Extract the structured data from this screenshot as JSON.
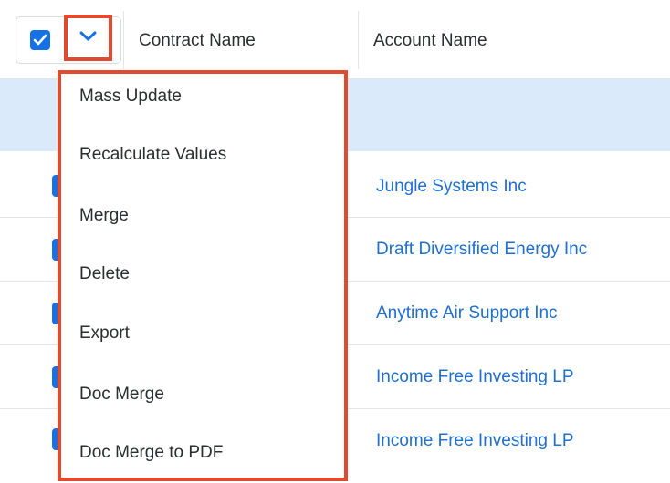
{
  "header": {
    "columns": [
      "Contract Name",
      "Account Name"
    ]
  },
  "actions_menu": {
    "items": [
      "Mass Update",
      "Recalculate Values",
      "Merge",
      "Delete",
      "Export",
      "Doc Merge",
      "Doc Merge to PDF"
    ]
  },
  "rows": [
    {
      "account": ""
    },
    {
      "account": "Jungle Systems Inc"
    },
    {
      "account": "Draft Diversified Energy Inc"
    },
    {
      "account": "Anytime Air Support Inc"
    },
    {
      "account": "Income Free Investing LP"
    },
    {
      "account": "Income Free Investing LP"
    }
  ],
  "colors": {
    "accent": "#1671e6",
    "highlight_border": "#e04b2f",
    "selected_row": "#dbeafb",
    "link": "#1f6fd1"
  },
  "icons": {
    "select_all": "checkbox-checked-icon",
    "menu_toggle": "chevron-down-icon"
  }
}
